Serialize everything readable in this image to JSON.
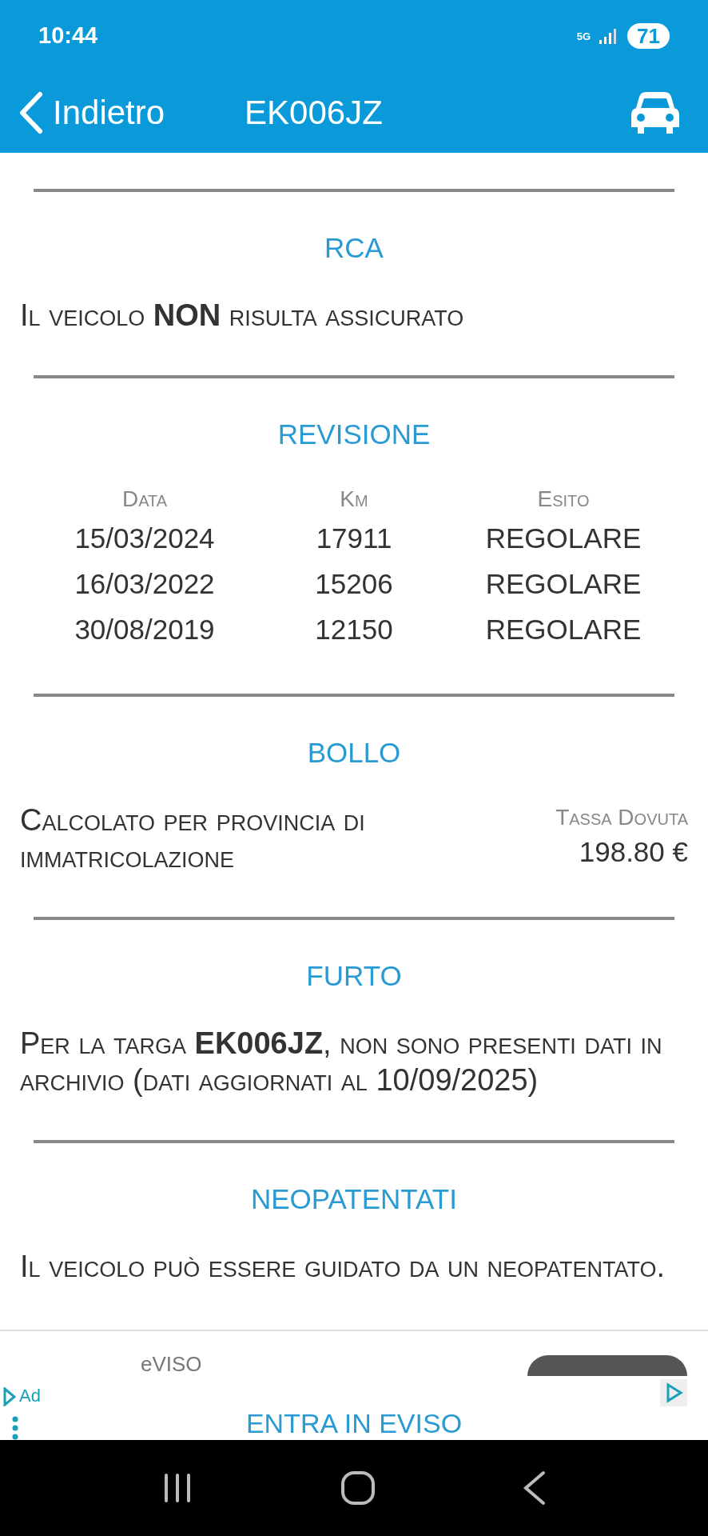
{
  "status_bar": {
    "time": "10:44",
    "network": "5G",
    "battery": "71"
  },
  "header": {
    "back": "Indietro",
    "title": "EK006JZ"
  },
  "sections": [
    {
      "kind": "text",
      "title": "RCA",
      "text": "Il veicolo **NON** risulta assicurato"
    },
    {
      "kind": "table",
      "title": "REVISIONE",
      "columns": [
        "Data",
        "Km",
        "Esito"
      ],
      "rows": [
        [
          "15/03/2024",
          "17911",
          "REGOLARE"
        ],
        [
          "16/03/2022",
          "15206",
          "REGOLARE"
        ],
        [
          "30/08/2019",
          "12150",
          "REGOLARE"
        ]
      ]
    },
    {
      "kind": "amount",
      "title": "BOLLO",
      "text": "Calcolato per provincia di immatricolazione",
      "label": "Tassa Dovuta",
      "value": "198.80 €"
    },
    {
      "kind": "text",
      "title": "FURTO",
      "text": "Per la targa **EK006JZ**, non sono presenti dati in archivio (dati aggiornati al 10/09/2025)"
    },
    {
      "kind": "text",
      "title": "NEOPATENTATI",
      "text": "Il veicolo può essere guidato da un neopatentato."
    }
  ],
  "ad": {
    "advertiser": "eVISO",
    "badge": "Ad",
    "cta": "ENTRA IN EVISO"
  }
}
